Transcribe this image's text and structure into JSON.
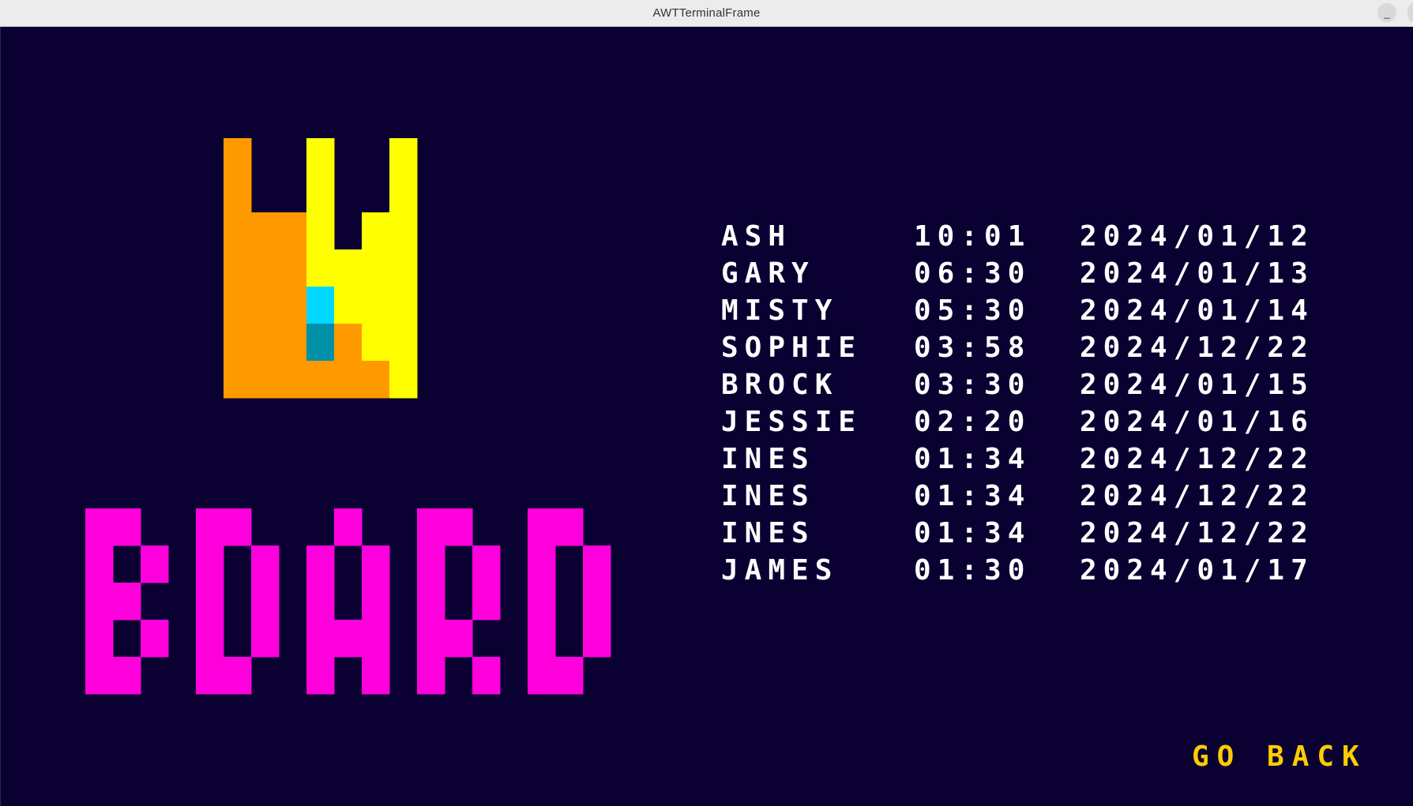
{
  "window": {
    "title": "AWTTerminalFrame",
    "minimize_label": "_"
  },
  "colors": {
    "background": "#0a0032",
    "text": "#ffffff",
    "accent": "#ffcc00",
    "crown_orange": "#ff9900",
    "crown_yellow": "#ffff00",
    "gem_light": "#00d8ff",
    "gem_dark": "#0090a8",
    "board_magenta": "#ff00dd"
  },
  "board_logo": {
    "text": "BOARD"
  },
  "scoreboard": {
    "rows": [
      {
        "name": "ASH",
        "time": "10:01",
        "date": "2024/01/12"
      },
      {
        "name": "GARY",
        "time": "06:30",
        "date": "2024/01/13"
      },
      {
        "name": "MISTY",
        "time": "05:30",
        "date": "2024/01/14"
      },
      {
        "name": "SOPHIE",
        "time": "03:58",
        "date": "2024/12/22"
      },
      {
        "name": "BROCK",
        "time": "03:30",
        "date": "2024/01/15"
      },
      {
        "name": "JESSIE",
        "time": "02:20",
        "date": "2024/01/16"
      },
      {
        "name": "INES",
        "time": "01:34",
        "date": "2024/12/22"
      },
      {
        "name": "INES",
        "time": "01:34",
        "date": "2024/12/22"
      },
      {
        "name": "INES",
        "time": "01:34",
        "date": "2024/12/22"
      },
      {
        "name": "JAMES",
        "time": "01:30",
        "date": "2024/01/17"
      }
    ]
  },
  "go_back_label": "GO BACK"
}
